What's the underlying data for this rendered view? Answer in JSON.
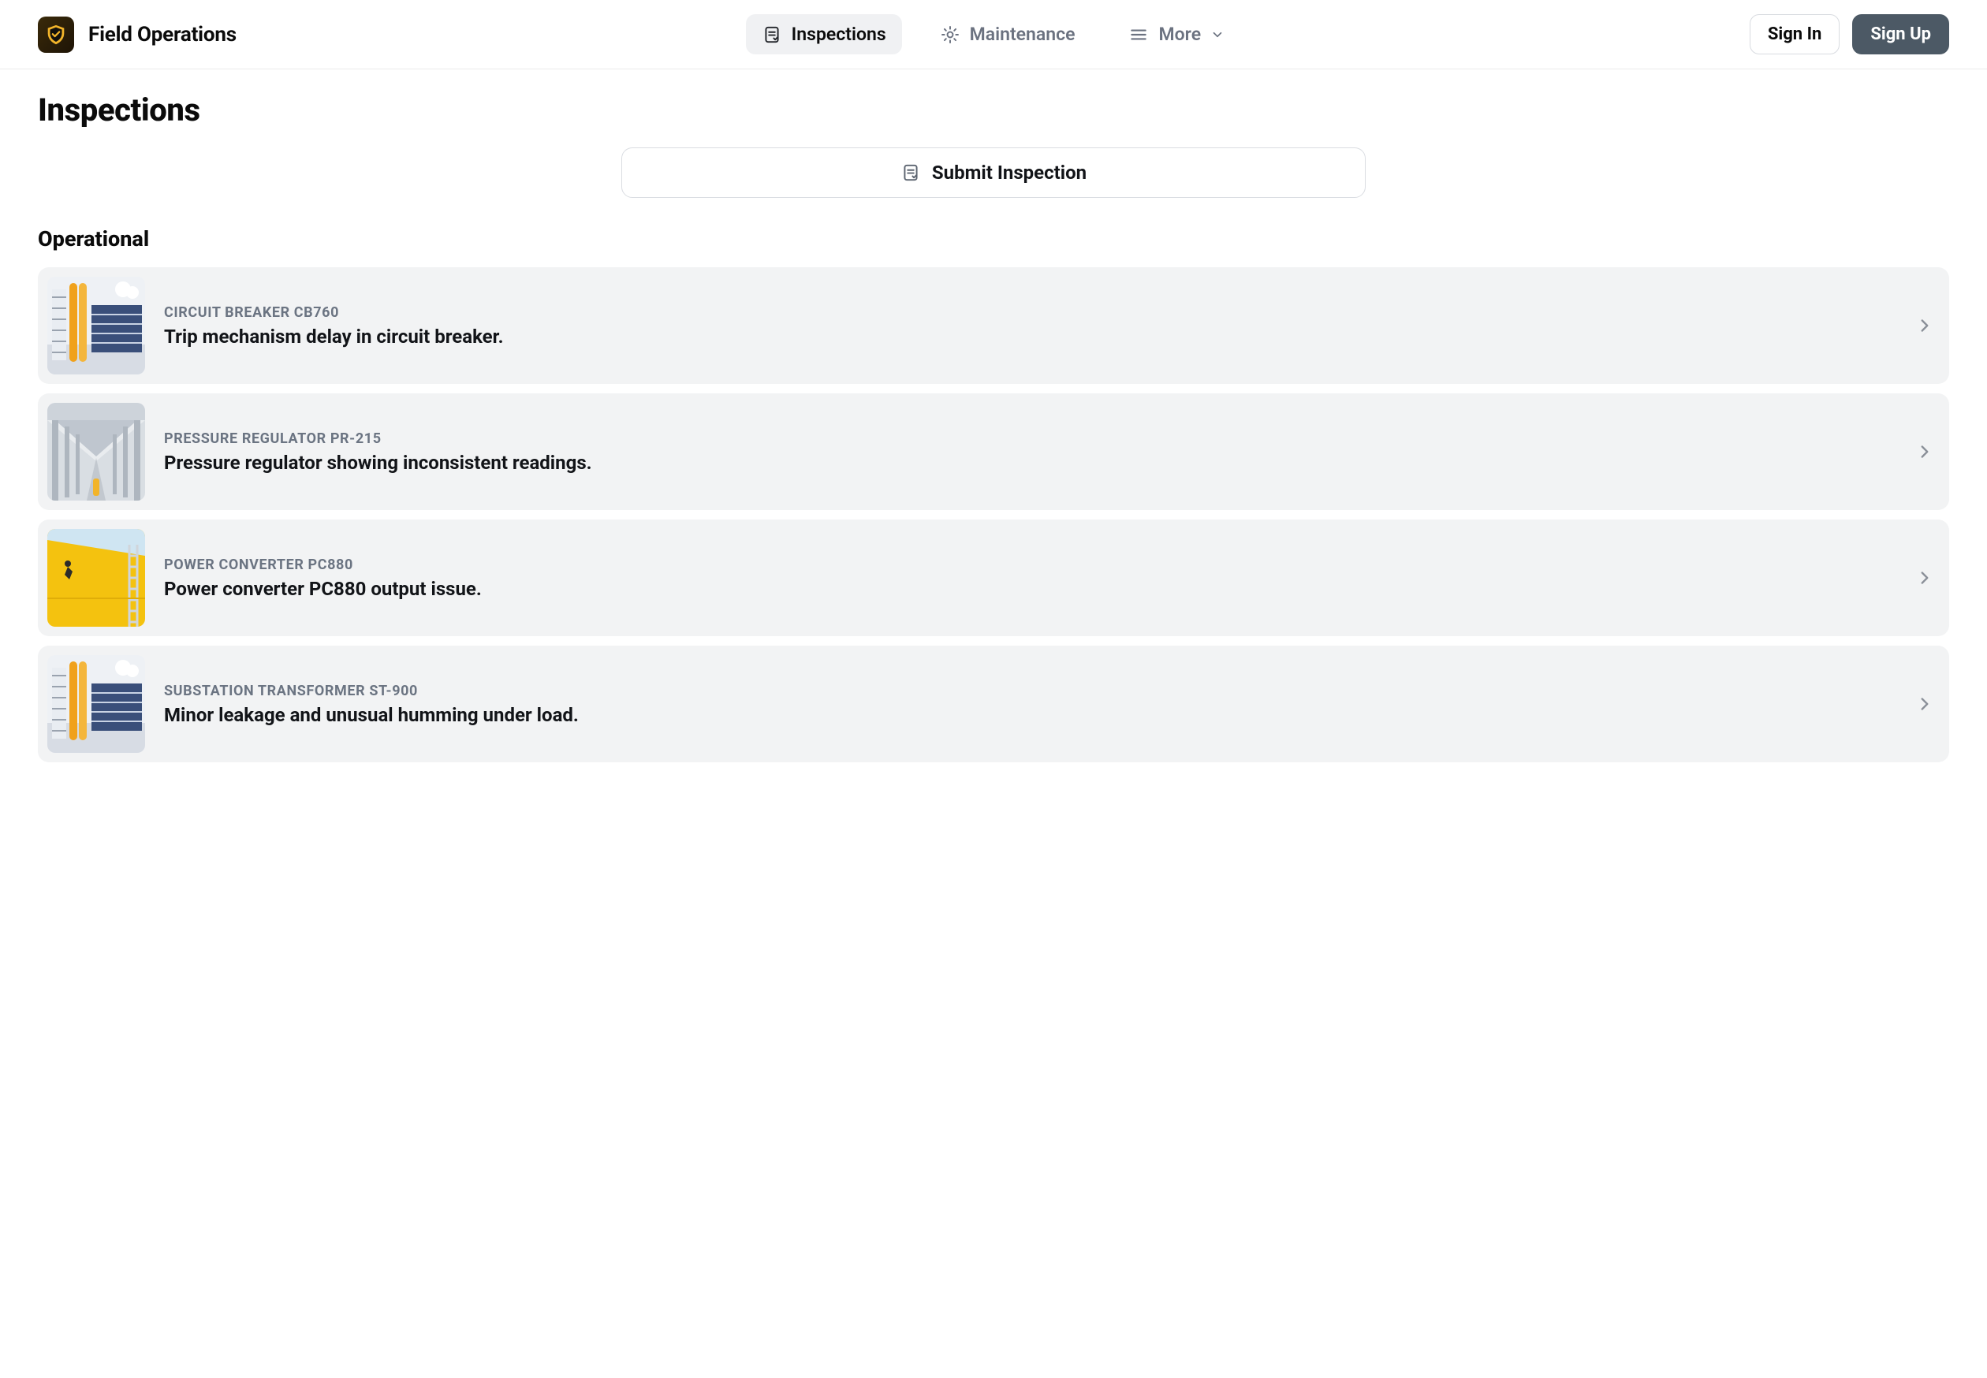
{
  "header": {
    "brand": "Field Operations",
    "nav": {
      "inspections": "Inspections",
      "maintenance": "Maintenance",
      "more": "More"
    },
    "actions": {
      "sign_in": "Sign In",
      "sign_up": "Sign Up"
    }
  },
  "page": {
    "title": "Inspections",
    "submit_label": "Submit Inspection",
    "section_title": "Operational"
  },
  "items": [
    {
      "equipment": "CIRCUIT BREAKER CB760",
      "description": "Trip mechanism delay in circuit breaker.",
      "thumb": "facility-a"
    },
    {
      "equipment": "PRESSURE REGULATOR PR-215",
      "description": "Pressure regulator showing inconsistent readings.",
      "thumb": "warehouse"
    },
    {
      "equipment": "POWER CONVERTER PC880",
      "description": "Power converter PC880 output issue.",
      "thumb": "yellow-wall"
    },
    {
      "equipment": "SUBSTATION TRANSFORMER ST-900",
      "description": "Minor leakage and unusual humming under load.",
      "thumb": "facility-a"
    }
  ]
}
